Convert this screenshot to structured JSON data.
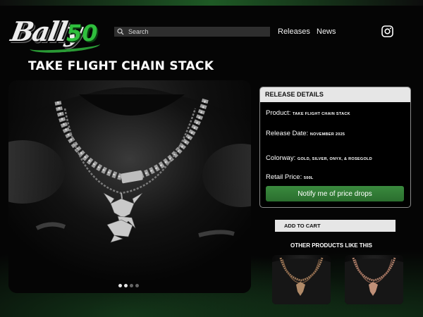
{
  "brand": {
    "logo_text": "Bally",
    "logo_number": "50"
  },
  "search": {
    "placeholder": "Search"
  },
  "nav": {
    "releases": "Releases",
    "news": "News"
  },
  "social": {
    "instagram_icon": "instagram-icon"
  },
  "product": {
    "title": "TAKE FLIGHT CHAIN STACK",
    "carousel": {
      "total": 4,
      "active": 1
    }
  },
  "release_details": {
    "header": "RELEASE DETAILS",
    "product_label": "Product:",
    "product_value": "TAKE FLIGHT CHAIN STACK",
    "date_label": "Release Date:",
    "date_value": "NOVEMBER 2025",
    "colorway_label": "Colorway:",
    "colorway_value": "GOLD, SILVER, ONYX, & ROSEGOLD",
    "price_label": "Retail Price:",
    "price_value": "500L",
    "notify_button": "Notify me of price drops"
  },
  "cart": {
    "add_to_cart": "ADD TO CART"
  },
  "related": {
    "title": "OTHER PRODUCTS LIKE THIS"
  },
  "colors": {
    "accent_green": "#2f7d33",
    "panel_header_bg": "#e6e6e6",
    "background": "#050505"
  }
}
